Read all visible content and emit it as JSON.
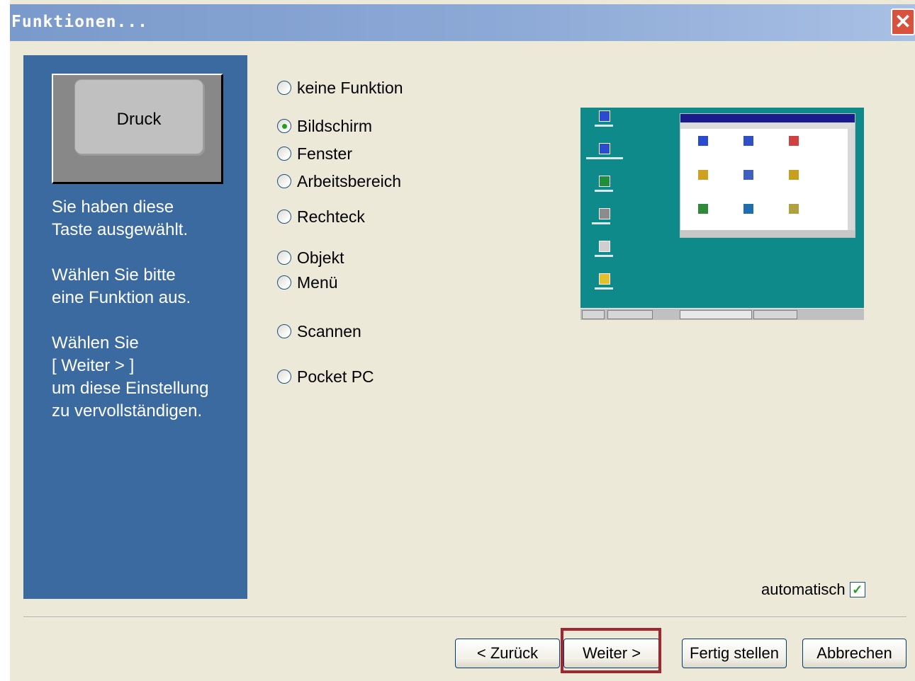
{
  "window": {
    "title": "Funktionen...",
    "close_symbol": "✕"
  },
  "left_panel": {
    "key_label": "Druck",
    "text_1": "Sie haben diese\nTaste ausgewählt.",
    "text_2": "Wählen Sie bitte\neine Funktion aus.",
    "text_3": "Wählen Sie\n    [ Weiter > ]\num diese Einstellung\nzu vervollständigen."
  },
  "options": {
    "keine_funktion": "keine Funktion",
    "bildschirm": "Bildschirm",
    "fenster": "Fenster",
    "arbeitsbereich": "Arbeitsbereich",
    "rechteck": "Rechteck",
    "objekt": "Objekt",
    "menue": "Menü",
    "scannen": "Scannen",
    "pocket_pc": "Pocket PC",
    "selected": "Bildschirm"
  },
  "automatisch": {
    "label": "automatisch",
    "checked": true,
    "check_symbol": "✓"
  },
  "buttons": {
    "back": "< Zurück",
    "next": "Weiter >",
    "finish": "Fertig stellen",
    "cancel": "Abbrechen"
  },
  "colors": {
    "left_panel": "#3b6aa0",
    "preview_desktop": "#0f8a8a",
    "highlight": "#a3252e",
    "dialog_bg": "#ece9d8"
  }
}
